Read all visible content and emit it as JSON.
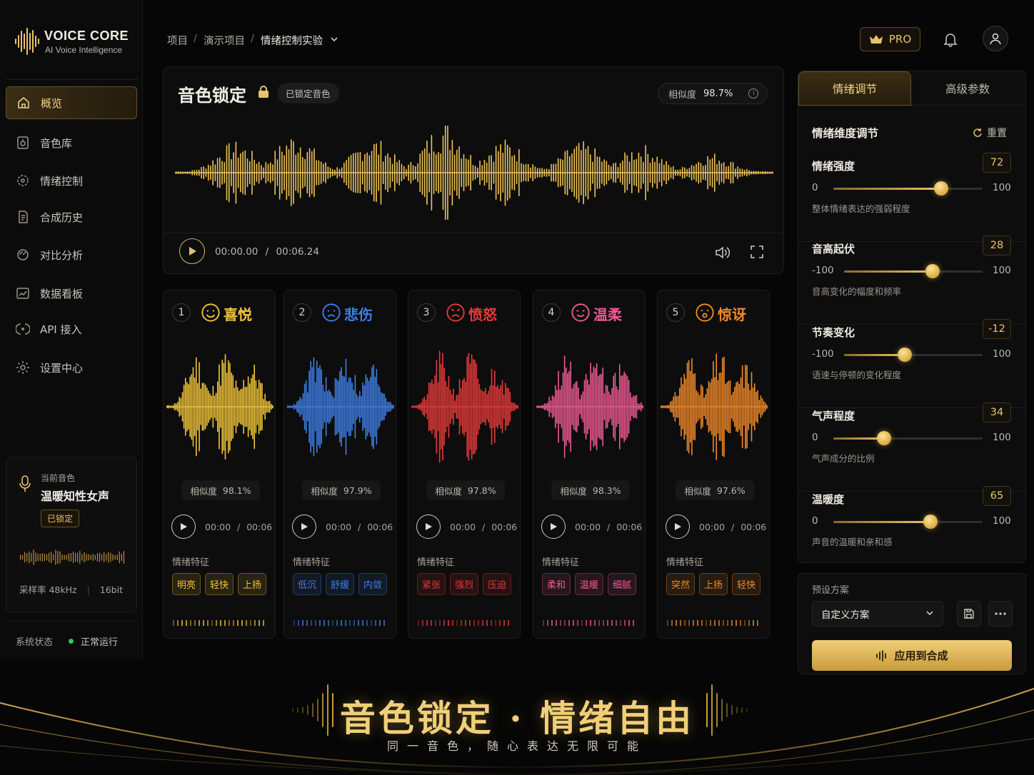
{
  "brand": {
    "name": "VOICE CORE",
    "tagline": "AI Voice Intelligence"
  },
  "colors": {
    "gold": "#e7c46c",
    "background": "#060606",
    "panel": "#0d0d0d",
    "status_ok": "#30c46a"
  },
  "sidebar": {
    "items": [
      {
        "label": "概览",
        "icon": "home-icon",
        "active": true
      },
      {
        "label": "音色库",
        "icon": "voice-library-icon"
      },
      {
        "label": "情绪控制",
        "icon": "emotion-control-icon"
      },
      {
        "label": "合成历史",
        "icon": "history-icon"
      },
      {
        "label": "对比分析",
        "icon": "compare-icon"
      },
      {
        "label": "数据看板",
        "icon": "dashboard-icon"
      },
      {
        "label": "API 接入",
        "icon": "api-icon"
      },
      {
        "label": "设置中心",
        "icon": "settings-icon"
      }
    ],
    "current_voice": {
      "label": "当前音色",
      "name": "温暖知性女声",
      "badge": "已锁定",
      "sample_rate": "采样率  48kHz",
      "bit_depth": "16bit"
    },
    "system": {
      "label": "系统状态",
      "status": "正常运行"
    }
  },
  "header": {
    "breadcrumb": [
      "项目",
      "演示项目",
      "情绪控制实验"
    ],
    "pro_label": "PRO"
  },
  "main": {
    "title": "音色锁定",
    "badge": "已锁定音色",
    "similarity_label": "相似度",
    "similarity": "98.7%",
    "time_current": "00:00.00",
    "time_total": "00:06.24"
  },
  "emotions": [
    {
      "num": "1",
      "name": "喜悦",
      "color": "#f2c53a",
      "similarity": "98.1%",
      "time": "00:00",
      "duration": "00:06",
      "tags": [
        "明亮",
        "轻快",
        "上扬"
      ]
    },
    {
      "num": "2",
      "name": "悲伤",
      "color": "#3f7fe6",
      "similarity": "97.9%",
      "time": "00:00",
      "duration": "00:06",
      "tags": [
        "低沉",
        "舒缓",
        "内敛"
      ]
    },
    {
      "num": "3",
      "name": "愤怒",
      "color": "#e63a3a",
      "similarity": "97.8%",
      "time": "00:00",
      "duration": "00:06",
      "tags": [
        "紧张",
        "强烈",
        "压迫"
      ]
    },
    {
      "num": "4",
      "name": "温柔",
      "color": "#ee5a93",
      "similarity": "98.3%",
      "time": "00:00",
      "duration": "00:06",
      "tags": [
        "柔和",
        "温暖",
        "细腻"
      ]
    },
    {
      "num": "5",
      "name": "惊讶",
      "color": "#f28a2a",
      "similarity": "97.6%",
      "time": "00:00",
      "duration": "00:06",
      "tags": [
        "突然",
        "上扬",
        "轻快"
      ]
    }
  ],
  "emotion_common": {
    "similarity_label": "相似度",
    "feature_label": "情绪特征"
  },
  "right_panel": {
    "tabs": [
      "情绪调节",
      "高级参数"
    ],
    "section_title": "情绪维度调节",
    "reset_label": "重置",
    "sliders": [
      {
        "name": "情绪强度",
        "value": 72,
        "min": 0,
        "max": 100,
        "desc": "整体情绪表达的强弱程度"
      },
      {
        "name": "音高起伏",
        "value": 28,
        "min": -100,
        "max": 100,
        "desc": "音高变化的幅度和频率"
      },
      {
        "name": "节奏变化",
        "value": -12,
        "min": -100,
        "max": 100,
        "desc": "语速与停顿的变化程度"
      },
      {
        "name": "气声程度",
        "value": 34,
        "min": 0,
        "max": 100,
        "desc": "气声成分的比例"
      },
      {
        "name": "温暖度",
        "value": 65,
        "min": 0,
        "max": 100,
        "desc": "声音的温暖和亲和感"
      }
    ]
  },
  "preset": {
    "label": "预设方案",
    "selected": "自定义方案",
    "apply_label": "应用到合成"
  },
  "banner": {
    "title": "音色锁定 · 情绪自由",
    "subtitle": "同一音色，随心表达无限可能"
  }
}
